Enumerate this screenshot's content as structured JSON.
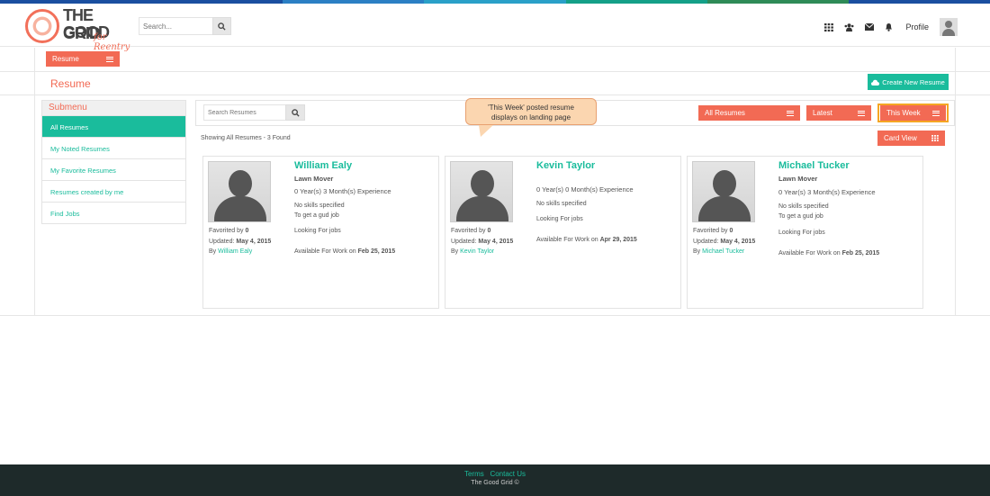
{
  "brand": {
    "line1": "THE GOOD",
    "line2": "GRID",
    "tagline": "for Reentry",
    "accent": "#f26a54",
    "teal": "#1abc9c"
  },
  "stripe_colors": [
    "#1a4fa0",
    "#1a4fa0",
    "#2b7fc4",
    "#2aa0c8",
    "#14a088",
    "#2e8b57",
    "#1a4fa0"
  ],
  "header": {
    "search_placeholder": "Search...",
    "icons": [
      "grid-icon",
      "users-icon",
      "mail-icon",
      "bell-icon"
    ],
    "profile_label": "Profile"
  },
  "resume_menu": {
    "label": "Resume"
  },
  "page": {
    "title": "Resume",
    "create_button": "Create New Resume"
  },
  "submenu": {
    "title": "Submenu",
    "items": [
      {
        "label": "All Resumes",
        "active": true
      },
      {
        "label": "My Noted Resumes"
      },
      {
        "label": "My Favorite Resumes"
      },
      {
        "label": "Resumes created by me"
      },
      {
        "label": "Find Jobs"
      }
    ]
  },
  "toolbar": {
    "search_placeholder": "Search Resumes",
    "filters": [
      "All Resumes",
      "Latest",
      "This Week"
    ],
    "showing": "Showing All Resumes - 3 Found",
    "card_view": "Card View"
  },
  "tooltip": {
    "line1": "'This Week' posted resume",
    "line2": "displays on landing page"
  },
  "cards": [
    {
      "name": "William Ealy",
      "job": "Lawn Mover",
      "experience": "0 Year(s) 3 Month(s) Experience",
      "skills": "No skills specified",
      "objective": "To get a gud job",
      "looking": "Looking For jobs",
      "available_label": "Available For Work on",
      "available_date": "Feb 25, 2015",
      "favorited_label": "Favorited by",
      "favorited_count": "0",
      "updated_label": "Updated:",
      "updated_date": "May 4, 2015",
      "by_label": "By",
      "by_name": "William Ealy"
    },
    {
      "name": "Kevin Taylor",
      "job": "",
      "experience": "0 Year(s) 0 Month(s) Experience",
      "skills": "No skills specified",
      "objective": "",
      "looking": "Looking For jobs",
      "available_label": "Available For Work on",
      "available_date": "Apr 29, 2015",
      "favorited_label": "Favorited by",
      "favorited_count": "0",
      "updated_label": "Updated:",
      "updated_date": "May 4, 2015",
      "by_label": "By",
      "by_name": "Kevin Taylor"
    },
    {
      "name": "Michael Tucker",
      "job": "Lawn Mover",
      "experience": "0 Year(s) 3 Month(s) Experience",
      "skills": "No skills specified",
      "objective": "To get a gud job",
      "looking": "Looking For jobs",
      "available_label": "Available For Work on",
      "available_date": "Feb 25, 2015",
      "favorited_label": "Favorited by",
      "favorited_count": "0",
      "updated_label": "Updated:",
      "updated_date": "May 4, 2015",
      "by_label": "By",
      "by_name": "Michael Tucker"
    }
  ],
  "footer": {
    "terms": "Terms",
    "contact": "Contact Us",
    "copyright": "The Good Grid ©"
  }
}
